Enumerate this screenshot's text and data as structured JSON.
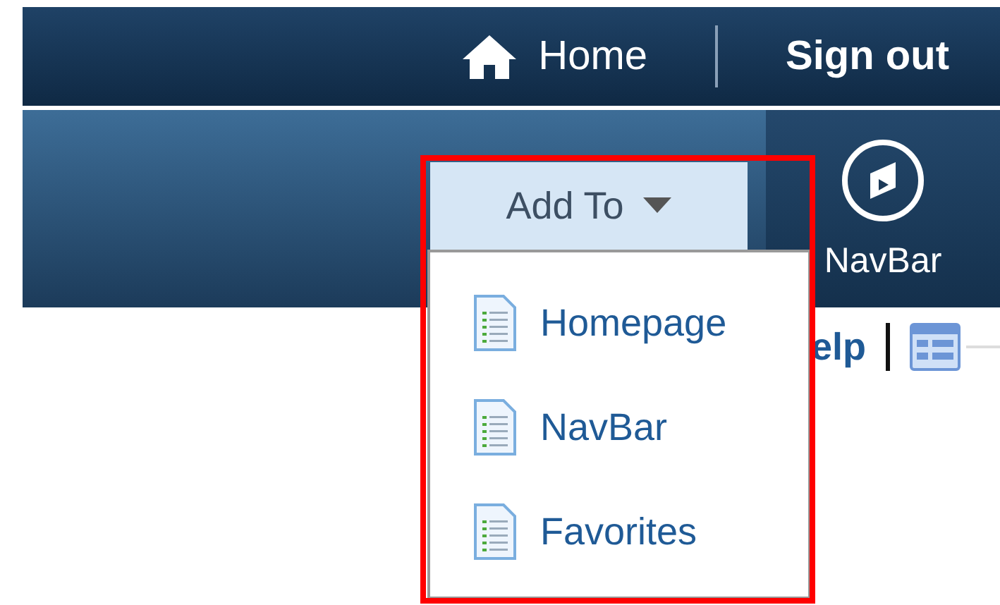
{
  "top_bar": {
    "links": [
      {
        "label": "Home",
        "kind": "home"
      },
      {
        "label": "Sign out",
        "kind": "plain"
      }
    ]
  },
  "nav_panel": {
    "label": "NavBar"
  },
  "toolbar": {
    "link": "elp"
  },
  "add_to": {
    "label": "Add To",
    "expanded": true,
    "items": [
      {
        "label": "Homepage"
      },
      {
        "label": "NavBar"
      },
      {
        "label": "Favorites"
      }
    ]
  }
}
